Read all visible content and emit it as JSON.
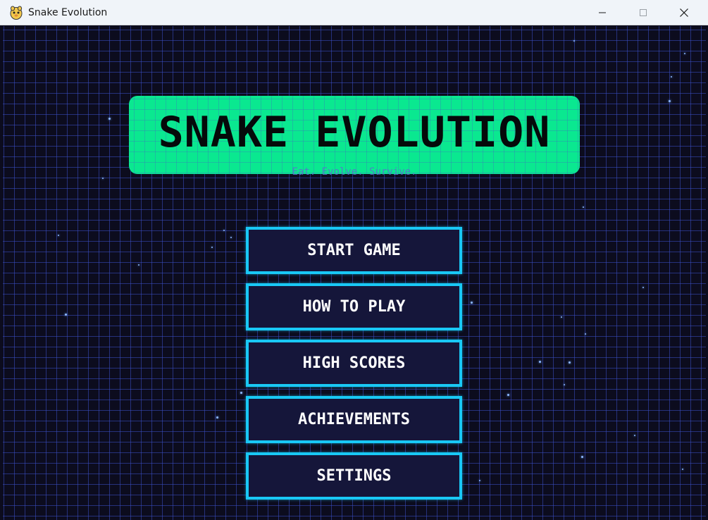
{
  "window": {
    "title": "Snake Evolution",
    "icon": "python-icon"
  },
  "game": {
    "title": "SNAKE EVOLUTION",
    "tagline": "Eat. Evolve. Survive.",
    "colors": {
      "background": "#0c0c1e",
      "grid": "#3c50c8",
      "banner": "#0ae890",
      "button_border": "#19c8f5",
      "button_fill": "#15163a",
      "button_text": "#ffffff"
    },
    "menu": [
      {
        "id": "start-game",
        "label": "START GAME"
      },
      {
        "id": "how-to-play",
        "label": "HOW TO PLAY"
      },
      {
        "id": "high-scores",
        "label": "HIGH SCORES"
      },
      {
        "id": "achievements",
        "label": "ACHIEVEMENTS"
      },
      {
        "id": "settings",
        "label": "SETTINGS"
      }
    ]
  }
}
